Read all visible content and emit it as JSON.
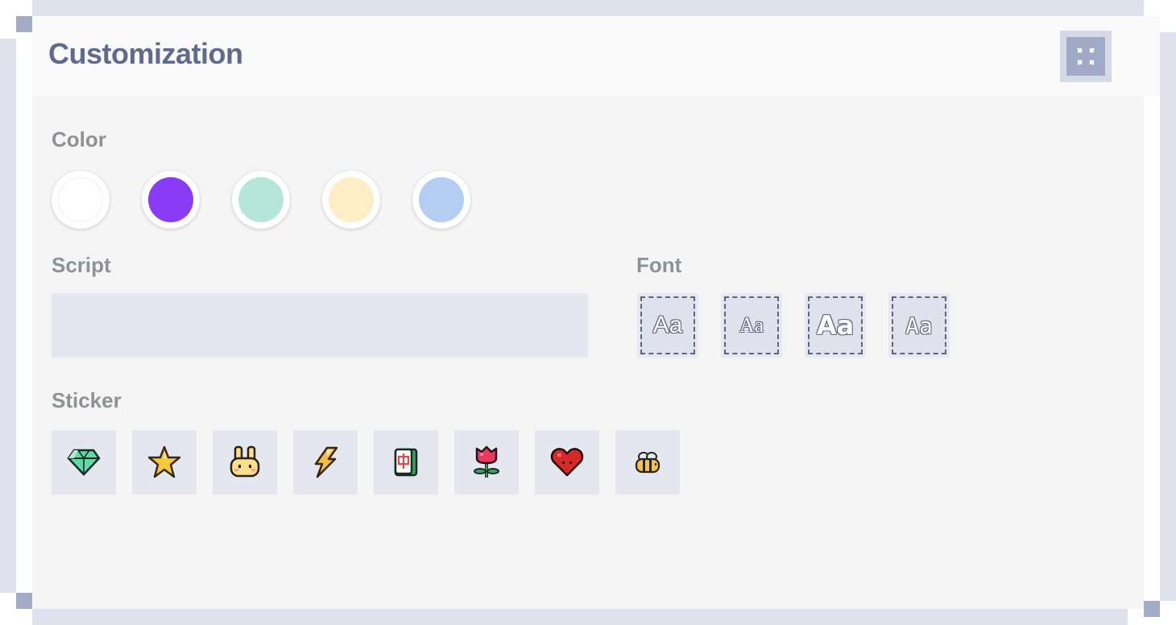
{
  "header": {
    "title": "Customization"
  },
  "sections": {
    "color_label": "Color",
    "script_label": "Script",
    "font_label": "Font",
    "sticker_label": "Sticker"
  },
  "colors": [
    "#ffffff",
    "#8a3bf5",
    "#b6e6d8",
    "#fdeec8",
    "#b6cdf3"
  ],
  "script": {
    "value": "",
    "placeholder": ""
  },
  "fonts": [
    {
      "label": "Aa"
    },
    {
      "label": "Aa"
    },
    {
      "label": "Aa"
    },
    {
      "label": "Aa"
    }
  ],
  "stickers": [
    "diamond-icon",
    "star-icon",
    "bunny-icon",
    "lightning-icon",
    "mahjong-tile-icon",
    "flower-icon",
    "heart-icon",
    "bee-icon"
  ]
}
